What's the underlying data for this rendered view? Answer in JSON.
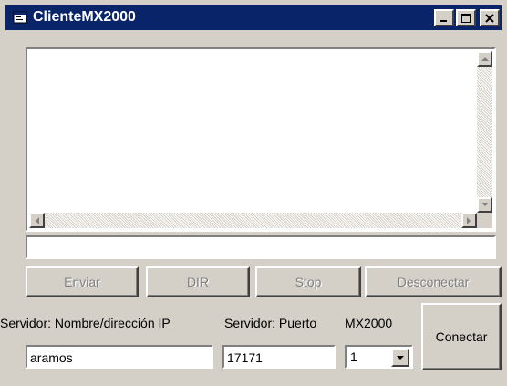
{
  "window": {
    "title": "ClienteMX2000",
    "controls": {
      "minimize_icon": "minimize-icon",
      "maximize_icon": "maximize-icon",
      "close_icon": "close-icon"
    }
  },
  "output_area": {
    "text": ""
  },
  "message_input": {
    "value": ""
  },
  "buttons": {
    "enviar": "Enviar",
    "dir": "DIR",
    "stop": "Stop",
    "desconectar": "Desconectar",
    "conectar": "Conectar"
  },
  "labels": {
    "server_host": "Servidor: Nombre/dirección IP",
    "server_port": "Servidor: Puerto",
    "mx2000": "MX2000"
  },
  "fields": {
    "host": "aramos",
    "port": "17171",
    "mx2000_selected": "1"
  },
  "colors": {
    "titlebar": "#0a246a",
    "face": "#d4d0c8",
    "disabled_text": "#808080"
  }
}
